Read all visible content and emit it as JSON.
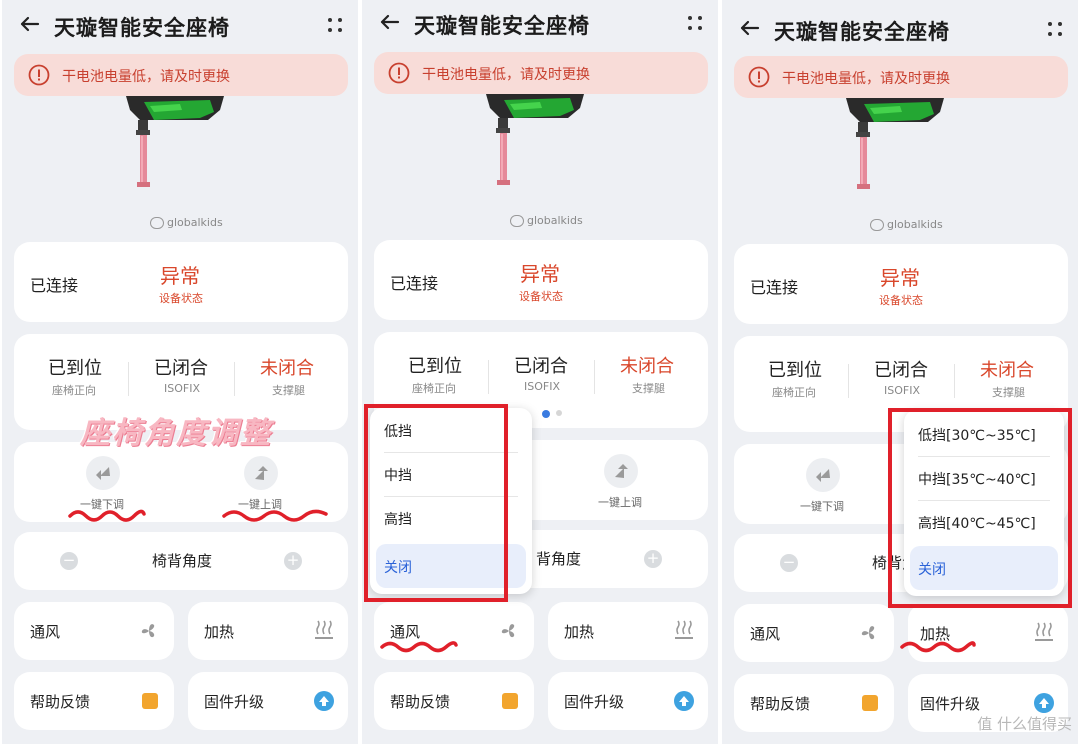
{
  "app": {
    "title": "天璇智能安全座椅",
    "alert": "干电池电量低，请及时更换",
    "logo": "globalkids"
  },
  "connection": {
    "label": "已连接",
    "status_value": "异常",
    "status_caption": "设备状态"
  },
  "installation": [
    {
      "value": "已到位",
      "caption": "座椅正向"
    },
    {
      "value": "已闭合",
      "caption": "ISOFIX"
    },
    {
      "value": "未闭合",
      "caption": "支撑腿"
    }
  ],
  "adjust": {
    "down_label": "一键下调",
    "up_label": "一键上调",
    "angle_label": "椅背角度",
    "angle_label_partial_p2": "背角度",
    "angle_label_partial_p3": "椅背角"
  },
  "features": {
    "ventilation": "通风",
    "heating": "加热",
    "help": "帮助反馈",
    "firmware": "固件升级"
  },
  "overlay_title": "座椅角度调整",
  "ventilation_menu": [
    "低挡",
    "中挡",
    "高挡",
    "关闭"
  ],
  "heating_menu": [
    "低挡[30℃~35℃]",
    "中挡[35℃~40℃]",
    "高挡[40℃~45℃]",
    "关闭"
  ],
  "footer_watermark": "值 什么值得买",
  "colors": {
    "accent_red": "#d9472b",
    "alert_bg": "#f8dcd8",
    "selected_blue": "#2a62d8",
    "annotation_red": "#e0202a"
  }
}
